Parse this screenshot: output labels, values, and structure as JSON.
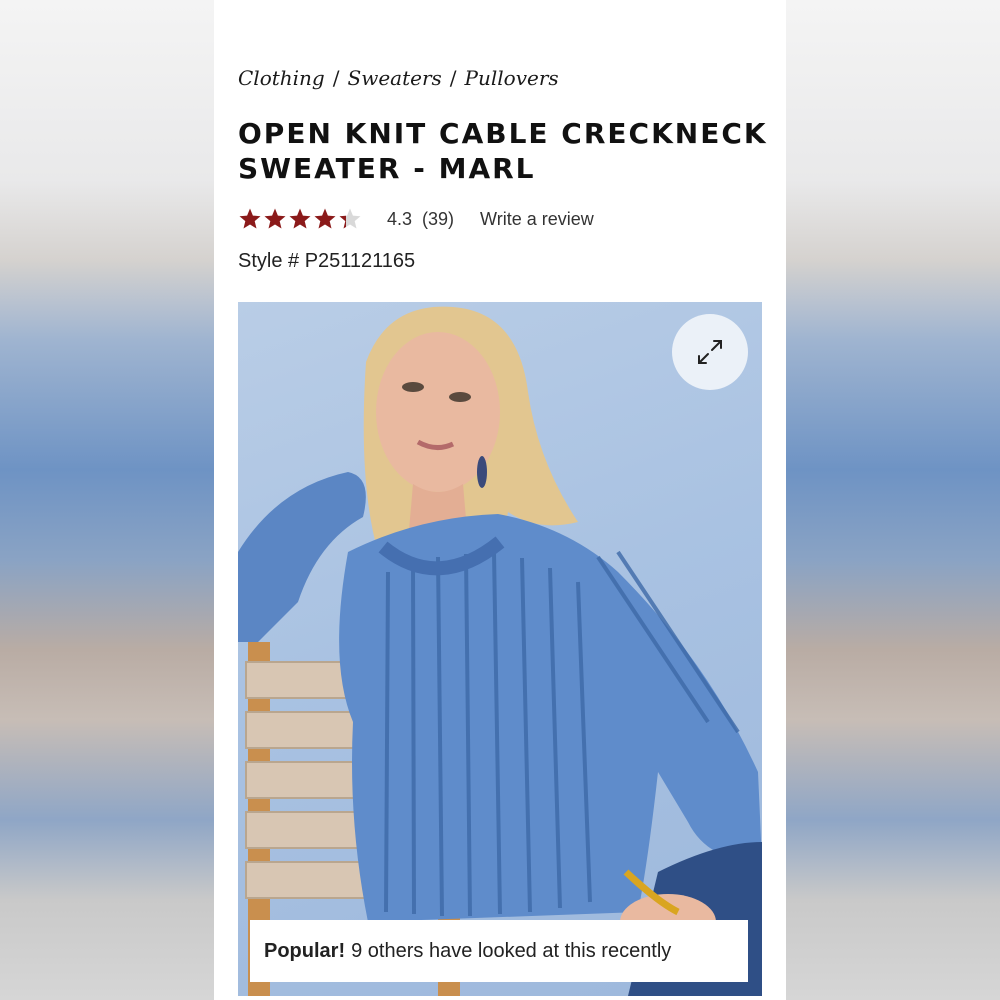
{
  "breadcrumb": {
    "items": [
      "Clothing",
      "Sweaters",
      "Pullovers"
    ],
    "separator": "/"
  },
  "product": {
    "title": "OPEN KNIT CABLE CRECKNECK SWEATER - MARL",
    "rating_value": "4.3",
    "rating_count": "(39)",
    "rating_fraction": 0.86,
    "write_review_label": "Write a review",
    "style_label": "Style # P251121165"
  },
  "colors": {
    "star": "#8b1a1a",
    "star_empty": "#d9d9d9"
  },
  "image": {
    "expand_icon": "expand-arrows-icon"
  },
  "popular_banner": {
    "bold": "Popular!",
    "text": "9 others have looked at this recently"
  }
}
